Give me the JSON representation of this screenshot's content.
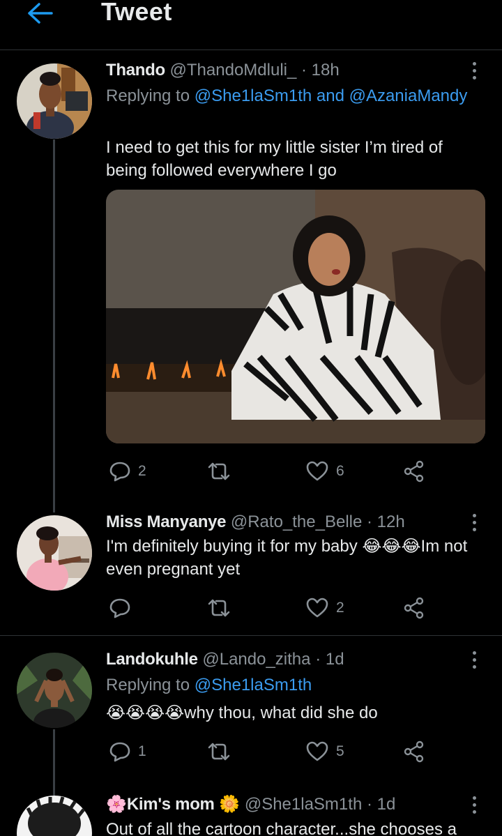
{
  "header": {
    "title": "Tweet",
    "back_icon": "back-arrow-icon",
    "accent": "#1d9bf0"
  },
  "tweets": [
    {
      "name": "Thando",
      "handle": "@ThandoMdluli_",
      "time": "· 18h",
      "replying_prefix": "Replying to",
      "replying_mentions": "@She1laSm1th and @AzaniaMandy",
      "text": "I need to get this for my little sister I’m tired of being followed everywhere I go",
      "replies": "2",
      "retweets": "",
      "likes": "6"
    },
    {
      "name": "Miss Manyanye",
      "handle": "@Rato_the_Belle",
      "time": "· 12h",
      "text_before": "I'm definitely buying it for my baby ",
      "emoji": "😂😂😂",
      "text_after": "Im not even pregnant yet",
      "replies": "",
      "retweets": "",
      "likes": "2"
    },
    {
      "name": "Landokuhle",
      "handle": "@Lando_zitha",
      "time": "· 1d",
      "replying_prefix": "Replying to",
      "replying_mentions": "@She1laSm1th",
      "emoji": "😭😭😭😭",
      "text": "why thou, what did she do",
      "replies": "1",
      "retweets": "",
      "likes": "5"
    },
    {
      "name": "Kim's mom",
      "name_prefix_emoji": "🌸",
      "name_suffix_emoji": "🌼",
      "handle": "@She1laSm1th",
      "time": "· 1d",
      "text": "Out of all the cartoon character...she chooses a"
    }
  ]
}
